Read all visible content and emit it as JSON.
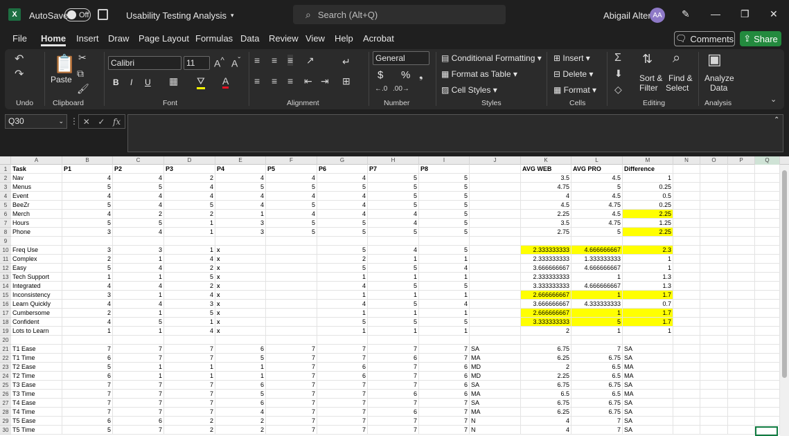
{
  "titlebar": {
    "autosave_label": "AutoSave",
    "toggle_state": "Off",
    "document_title": "Usability Testing Analysis",
    "search_placeholder": "Search (Alt+Q)",
    "user_name": "Abigail Alter",
    "avatar_initials": "AA",
    "app_icon": "X"
  },
  "menu": {
    "tabs": [
      "File",
      "Home",
      "Insert",
      "Draw",
      "Page Layout",
      "Formulas",
      "Data",
      "Review",
      "View",
      "Help",
      "Acrobat"
    ],
    "comments_label": "Comments",
    "share_label": "Share"
  },
  "ribbon": {
    "undo": "Undo",
    "clipboard": "Clipboard",
    "paste": "Paste",
    "font_label": "Font",
    "font_name": "Calibri",
    "font_size": "11",
    "alignment": "Alignment",
    "number_format": "General",
    "number": "Number",
    "conditional_formatting": "Conditional Formatting",
    "format_as_table": "Format as Table",
    "cell_styles": "Cell Styles",
    "styles": "Styles",
    "insert": "Insert",
    "delete": "Delete",
    "format": "Format",
    "cells": "Cells",
    "sort_filter_1": "Sort &",
    "sort_filter_2": "Filter",
    "find_select_1": "Find &",
    "find_select_2": "Select",
    "editing": "Editing",
    "analyze_1": "Analyze",
    "analyze_2": "Data",
    "analysis": "Analysis",
    "bold": "B",
    "italic": "I",
    "underline": "U",
    "currency": "$",
    "percent": "%"
  },
  "formula": {
    "namebox": "Q30",
    "fx": "fx"
  },
  "sheet": {
    "columns": [
      "A",
      "B",
      "C",
      "D",
      "E",
      "F",
      "G",
      "H",
      "I",
      "J",
      "K",
      "L",
      "M",
      "N",
      "O",
      "P",
      "Q"
    ],
    "rows": [
      [
        "Task",
        "P1",
        "P2",
        "P3",
        "P4",
        "P5",
        "P6",
        "P7",
        "P8",
        "",
        "AVG WEB",
        "AVG PRO",
        "Difference"
      ],
      [
        "Nav",
        "4",
        "4",
        "2",
        "4",
        "4",
        "4",
        "5",
        "5",
        "",
        "3.5",
        "4.5",
        "1"
      ],
      [
        "Menus",
        "5",
        "5",
        "4",
        "5",
        "5",
        "5",
        "5",
        "5",
        "",
        "4.75",
        "5",
        "0.25"
      ],
      [
        "Event",
        "4",
        "4",
        "4",
        "4",
        "4",
        "4",
        "5",
        "5",
        "",
        "4",
        "4.5",
        "0.5"
      ],
      [
        "BeeZr",
        "5",
        "4",
        "5",
        "4",
        "5",
        "4",
        "5",
        "5",
        "",
        "4.5",
        "4.75",
        "0.25"
      ],
      [
        "Merch",
        "4",
        "2",
        "2",
        "1",
        "4",
        "4",
        "4",
        "5",
        "",
        "2.25",
        "4.5",
        "2.25"
      ],
      [
        "Hours",
        "5",
        "5",
        "1",
        "3",
        "5",
        "5",
        "4",
        "5",
        "",
        "3.5",
        "4.75",
        "1.25"
      ],
      [
        "Phone",
        "3",
        "4",
        "1",
        "3",
        "5",
        "5",
        "5",
        "5",
        "",
        "2.75",
        "5",
        "2.25"
      ],
      [
        "",
        "",
        "",
        "",
        "",
        "",
        "",
        "",
        "",
        "",
        "",
        "",
        ""
      ],
      [
        "Freq Use",
        "3",
        "3",
        "1 x",
        "x",
        "",
        "5",
        "4",
        "5",
        "",
        "2.333333333",
        "4.666666667",
        "2.3"
      ],
      [
        "Complex",
        "2",
        "1",
        "4 x",
        "x",
        "",
        "2",
        "1",
        "1",
        "",
        "2.333333333",
        "1.333333333",
        "1"
      ],
      [
        "Easy",
        "5",
        "4",
        "2 x",
        "x",
        "",
        "5",
        "5",
        "4",
        "",
        "3.666666667",
        "4.666666667",
        "1"
      ],
      [
        "Tech Support",
        "1",
        "1",
        "5 x",
        "x",
        "",
        "1",
        "1",
        "1",
        "",
        "2.333333333",
        "1",
        "1.3"
      ],
      [
        "Integrated",
        "4",
        "4",
        "2 x",
        "x",
        "",
        "4",
        "5",
        "5",
        "",
        "3.333333333",
        "4.666666667",
        "1.3"
      ],
      [
        "Inconsistency",
        "3",
        "1",
        "4 x",
        "x",
        "",
        "1",
        "1",
        "1",
        "",
        "2.666666667",
        "1",
        "1.7"
      ],
      [
        "Learn Quickly",
        "4",
        "4",
        "3 x",
        "x",
        "",
        "4",
        "5",
        "4",
        "",
        "3.666666667",
        "4.333333333",
        "0.7"
      ],
      [
        "Cumbersome",
        "2",
        "1",
        "5 x",
        "x",
        "",
        "1",
        "1",
        "1",
        "",
        "2.666666667",
        "1",
        "1.7"
      ],
      [
        "Confident",
        "4",
        "5",
        "1 x",
        "x",
        "",
        "5",
        "5",
        "5",
        "",
        "3.333333333",
        "5",
        "1.7"
      ],
      [
        "Lots to Learn",
        "1",
        "1",
        "4 x",
        "x",
        "",
        "1",
        "1",
        "1",
        "",
        "2",
        "1",
        "1"
      ],
      [
        "",
        "",
        "",
        "",
        "",
        "",
        "",
        "",
        "",
        "",
        "",
        "",
        ""
      ],
      [
        "T1 Ease",
        "7",
        "7",
        "7",
        "6",
        "7",
        "7",
        "7",
        "7 SA",
        "",
        "6.75",
        "7 SA",
        ""
      ],
      [
        "T1 Time",
        "6",
        "7",
        "7",
        "5",
        "7",
        "7",
        "6",
        "7 MA",
        "",
        "6.25",
        "6.75 SA",
        ""
      ],
      [
        "T2 Ease",
        "5",
        "1",
        "1",
        "1",
        "7",
        "6",
        "7",
        "6 MD",
        "",
        "2",
        "6.5 MA",
        ""
      ],
      [
        "T2 Time",
        "6",
        "1",
        "1",
        "1",
        "7",
        "6",
        "7",
        "6 MD",
        "",
        "2.25",
        "6.5 MA",
        ""
      ],
      [
        "T3 Ease",
        "7",
        "7",
        "7",
        "6",
        "7",
        "7",
        "7",
        "6 SA",
        "",
        "6.75",
        "6.75 SA",
        ""
      ],
      [
        "T3 Time",
        "7",
        "7",
        "7",
        "5",
        "7",
        "7",
        "6",
        "6 MA",
        "",
        "6.5",
        "6.5 MA",
        ""
      ],
      [
        "T4 Ease",
        "7",
        "7",
        "7",
        "6",
        "7",
        "7",
        "7",
        "7 SA",
        "",
        "6.75",
        "6.75 SA",
        ""
      ],
      [
        "T4 Time",
        "7",
        "7",
        "7",
        "4",
        "7",
        "7",
        "6",
        "7 MA",
        "",
        "6.25",
        "6.75 SA",
        ""
      ],
      [
        "T5 Ease",
        "6",
        "6",
        "2",
        "2",
        "7",
        "7",
        "7",
        "7 N",
        "",
        "4",
        "7 SA",
        ""
      ],
      [
        "T5 Time",
        "5",
        "7",
        "2",
        "2",
        "7",
        "7",
        "7",
        "7 N",
        "",
        "4",
        "7 SA",
        ""
      ]
    ],
    "highlight": {
      "diff_rows": [
        6,
        8,
        10,
        15,
        17,
        18
      ],
      "avg_rows": [
        10,
        15,
        17,
        18
      ]
    },
    "highlight_color": "#ffff00"
  },
  "colors": {
    "accent_green": "#107c41",
    "share_green": "#238a3e"
  }
}
